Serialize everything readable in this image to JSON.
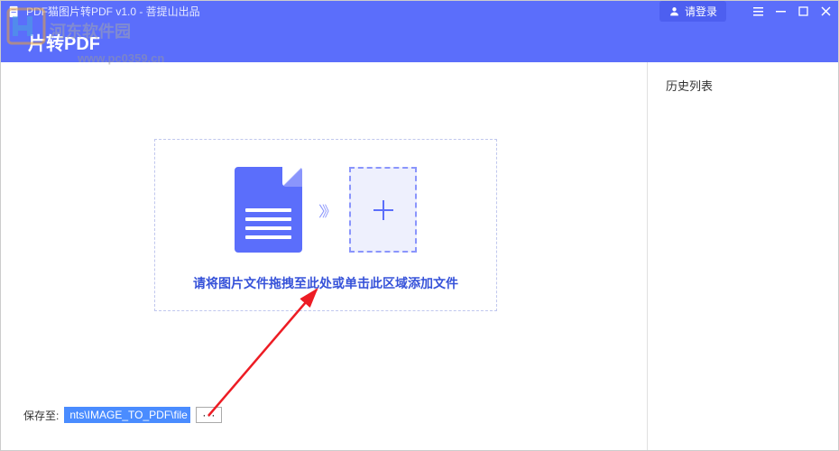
{
  "titlebar": {
    "title": "PDF猫图片转PDF v1.0 - 菩提山出品",
    "login_label": "请登录"
  },
  "header": {
    "title": "片转PDF"
  },
  "watermark": {
    "text": "河东软件园",
    "url": "www.pc0359.cn"
  },
  "dropzone": {
    "instruction": "请将图片文件拖拽至此处或单击此区域添加文件",
    "arrow": "〉》"
  },
  "sidebar": {
    "history_title": "历史列表"
  },
  "save": {
    "label": "保存至:",
    "path": "nts\\IMAGE_TO_PDF\\file",
    "browse": "···"
  }
}
